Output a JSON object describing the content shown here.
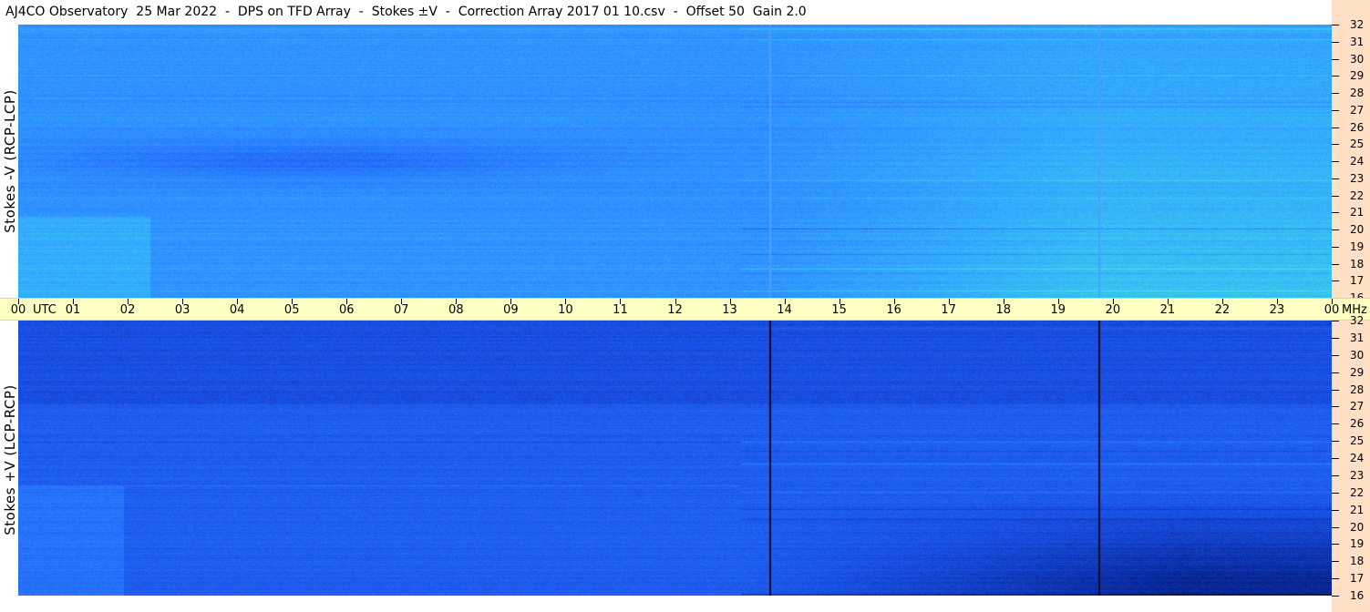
{
  "title": "AJ4CO Observatory  25 Mar 2022  -  DPS on TFD Array  -  Stokes ±V  -  Correction Array 2017 01 10.csv  -  Offset 50  Gain 2.0",
  "chart_data": [
    {
      "type": "heatmap",
      "panel": "top",
      "ylabel": "Stokes -V (RCP-LCP)",
      "xlabel": "UTC",
      "x_unit": "UTC",
      "y_unit": "MHz",
      "x_ticks": [
        "00",
        "01",
        "02",
        "03",
        "04",
        "05",
        "06",
        "07",
        "08",
        "09",
        "10",
        "11",
        "12",
        "13",
        "14",
        "15",
        "16",
        "17",
        "18",
        "19",
        "20",
        "21",
        "22",
        "23",
        "00"
      ],
      "y_ticks": [
        32,
        31,
        30,
        29,
        28,
        27,
        26,
        25,
        24,
        23,
        22,
        21,
        20,
        19,
        18,
        17,
        16
      ],
      "xlim": [
        0,
        24
      ],
      "ylim": [
        16,
        32
      ],
      "vertical_lines_hours": [
        13.72,
        19.73
      ],
      "vertical_line_color": "#4a9fff",
      "color_scale": [
        "#0a2a9e",
        "#1a52e8",
        "#2a7cff",
        "#34a8ff",
        "#3ad8e8",
        "#6ef0a0",
        "#e8f050",
        "#ff5a5a"
      ]
    },
    {
      "type": "heatmap",
      "panel": "bottom",
      "ylabel": "Stokes +V (LCP-RCP)",
      "xlabel": "UTC",
      "x_unit": "UTC",
      "y_unit": "MHz",
      "x_ticks": [
        "00",
        "01",
        "02",
        "03",
        "04",
        "05",
        "06",
        "07",
        "08",
        "09",
        "10",
        "11",
        "12",
        "13",
        "14",
        "15",
        "16",
        "17",
        "18",
        "19",
        "20",
        "21",
        "22",
        "23",
        "00"
      ],
      "y_ticks": [
        32,
        31,
        30,
        29,
        28,
        27,
        26,
        25,
        24,
        23,
        22,
        21,
        20,
        19,
        18,
        17,
        16
      ],
      "xlim": [
        0,
        24
      ],
      "ylim": [
        16,
        32
      ],
      "vertical_lines_hours": [
        13.72,
        19.73
      ],
      "vertical_line_color": "#02061e",
      "color_scale": [
        "#000a40",
        "#0a2a9e",
        "#1a52e8",
        "#2a7cff",
        "#34a8ff",
        "#3ad8e8",
        "#6ef0a0"
      ]
    }
  ]
}
